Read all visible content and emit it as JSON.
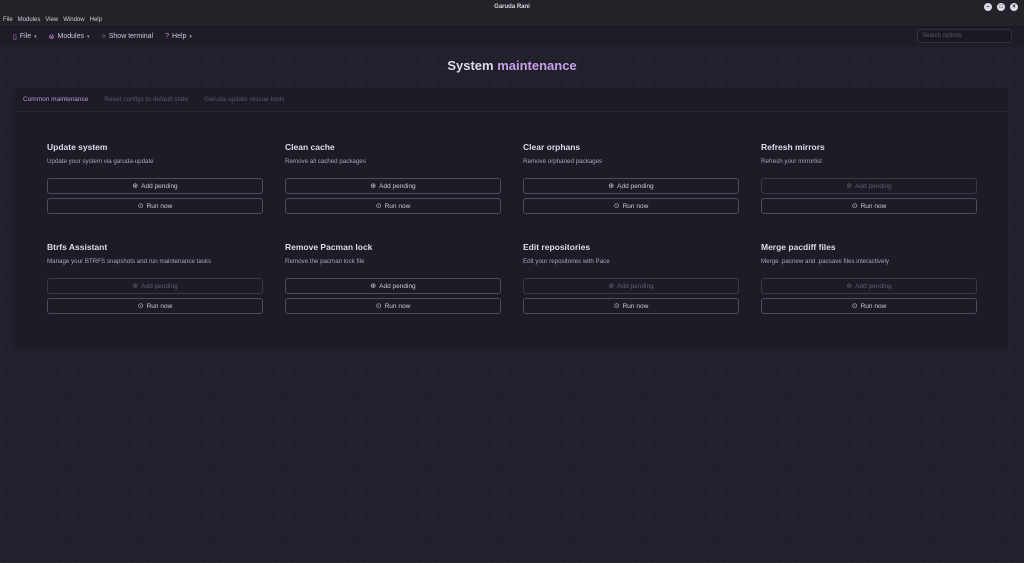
{
  "window": {
    "title": "Garuda Rani"
  },
  "menubar": [
    "File",
    "Modules",
    "View",
    "Window",
    "Help"
  ],
  "toolbar": {
    "file": "File",
    "modules": "Modules",
    "terminal": "Show terminal",
    "help": "Help",
    "search_placeholder": "Search options"
  },
  "page": {
    "title_main": "System ",
    "title_accent": "maintenance"
  },
  "tabs": [
    "Common maintenance",
    "Reset configs to default state",
    "Garuda update rescue tools"
  ],
  "cards": [
    {
      "title": "Update system",
      "desc": "Update your system via garuda-update",
      "pending": "Add pending",
      "run": "Run now",
      "pending_enabled": true
    },
    {
      "title": "Clean cache",
      "desc": "Remove all cached packages",
      "pending": "Add pending",
      "run": "Run now",
      "pending_enabled": true
    },
    {
      "title": "Clear orphans",
      "desc": "Remove orphaned packages",
      "pending": "Add pending",
      "run": "Run now",
      "pending_enabled": true
    },
    {
      "title": "Refresh mirrors",
      "desc": "Refresh your mirrorlist",
      "pending": "Add pending",
      "run": "Run now",
      "pending_enabled": false
    },
    {
      "title": "Btrfs Assistant",
      "desc": "Manage your BTRFS snapshots and run maintenance tasks",
      "pending": "Add pending",
      "run": "Run now",
      "pending_enabled": false
    },
    {
      "title": "Remove Pacman lock",
      "desc": "Remove the pacman lock file",
      "pending": "Add pending",
      "run": "Run now",
      "pending_enabled": true
    },
    {
      "title": "Edit repositories",
      "desc": "Edit your repositories with Pace",
      "pending": "Add pending",
      "run": "Run now",
      "pending_enabled": false
    },
    {
      "title": "Merge pacdiff files",
      "desc": "Merge .pacnew and .pacsave files interactively",
      "pending": "Add pending",
      "run": "Run now",
      "pending_enabled": false
    }
  ]
}
